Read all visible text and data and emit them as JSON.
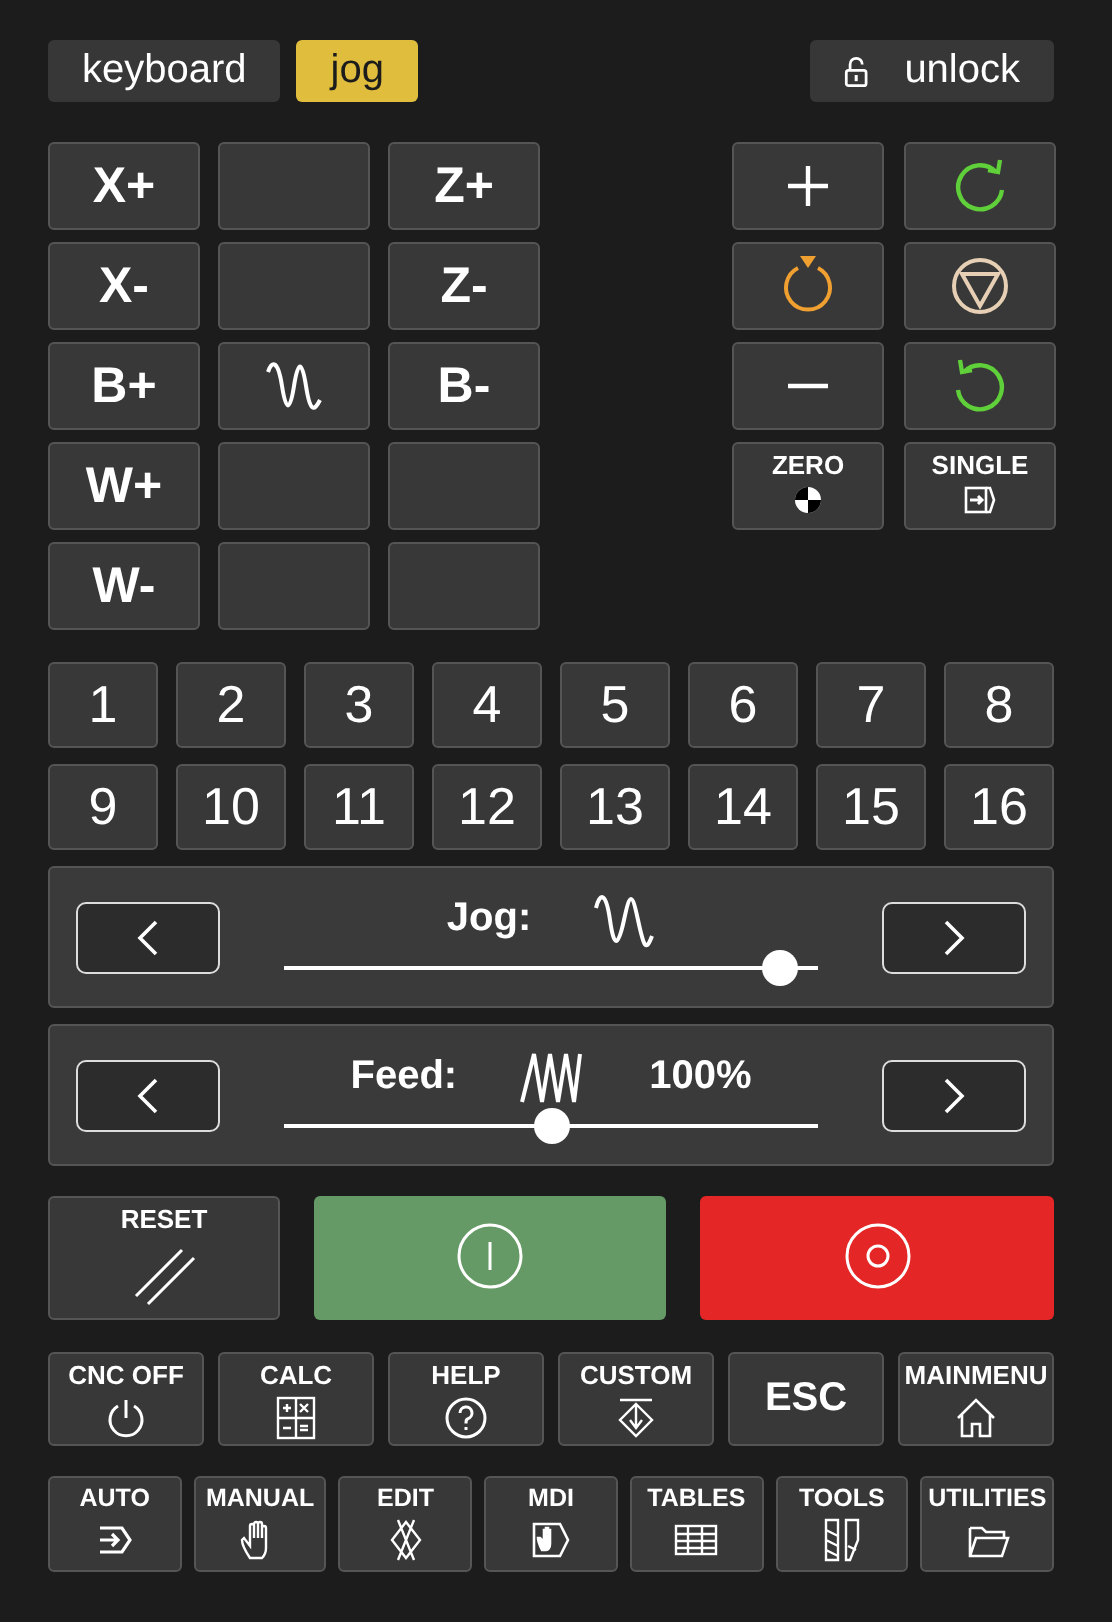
{
  "tabs": [
    {
      "label": "keyboard",
      "selected": false
    },
    {
      "label": "jog",
      "selected": true
    }
  ],
  "unlock": {
    "label": "unlock"
  },
  "axis_keys": [
    {
      "kind": "text",
      "label": "X+"
    },
    {
      "kind": "blank"
    },
    {
      "kind": "text",
      "label": "Z+"
    },
    {
      "kind": "text",
      "label": "X-"
    },
    {
      "kind": "blank"
    },
    {
      "kind": "text",
      "label": "Z-"
    },
    {
      "kind": "text",
      "label": "B+"
    },
    {
      "kind": "wave"
    },
    {
      "kind": "text",
      "label": "B-"
    },
    {
      "kind": "text",
      "label": "W+"
    },
    {
      "kind": "blank"
    },
    {
      "kind": "blank"
    },
    {
      "kind": "text",
      "label": "W-"
    },
    {
      "kind": "blank"
    },
    {
      "kind": "blank"
    }
  ],
  "control_keys": [
    {
      "kind": "plus"
    },
    {
      "kind": "rotate-cw"
    },
    {
      "kind": "spindle"
    },
    {
      "kind": "stop"
    },
    {
      "kind": "minus"
    },
    {
      "kind": "rotate-ccw"
    },
    {
      "kind": "zero",
      "label": "ZERO"
    },
    {
      "kind": "single",
      "label": "SINGLE"
    }
  ],
  "number_keys": [
    "1",
    "2",
    "3",
    "4",
    "5",
    "6",
    "7",
    "8",
    "9",
    "10",
    "11",
    "12",
    "13",
    "14",
    "15",
    "16"
  ],
  "sliders": [
    {
      "kind": "jog",
      "label": "Jog:",
      "level": 0.96
    },
    {
      "kind": "feed",
      "label": "Feed:",
      "reading": "100%",
      "level": 0.5
    }
  ],
  "reset": {
    "label": "RESET"
  },
  "function_keys": [
    {
      "kind": "power",
      "label": "CNC OFF"
    },
    {
      "kind": "calc",
      "label": "CALC"
    },
    {
      "kind": "help",
      "label": "HELP"
    },
    {
      "kind": "custom",
      "label": "CUSTOM"
    },
    {
      "kind": "none",
      "label": "ESC"
    },
    {
      "kind": "home",
      "label": "MAINMENU"
    }
  ],
  "mode_keys": [
    {
      "kind": "auto",
      "label": "AUTO"
    },
    {
      "kind": "manual",
      "label": "MANUAL"
    },
    {
      "kind": "edit",
      "label": "EDIT"
    },
    {
      "kind": "mdi",
      "label": "MDI"
    },
    {
      "kind": "tables",
      "label": "TABLES"
    },
    {
      "kind": "tools",
      "label": "TOOLS"
    },
    {
      "kind": "utilities",
      "label": "UTILITIES"
    }
  ]
}
